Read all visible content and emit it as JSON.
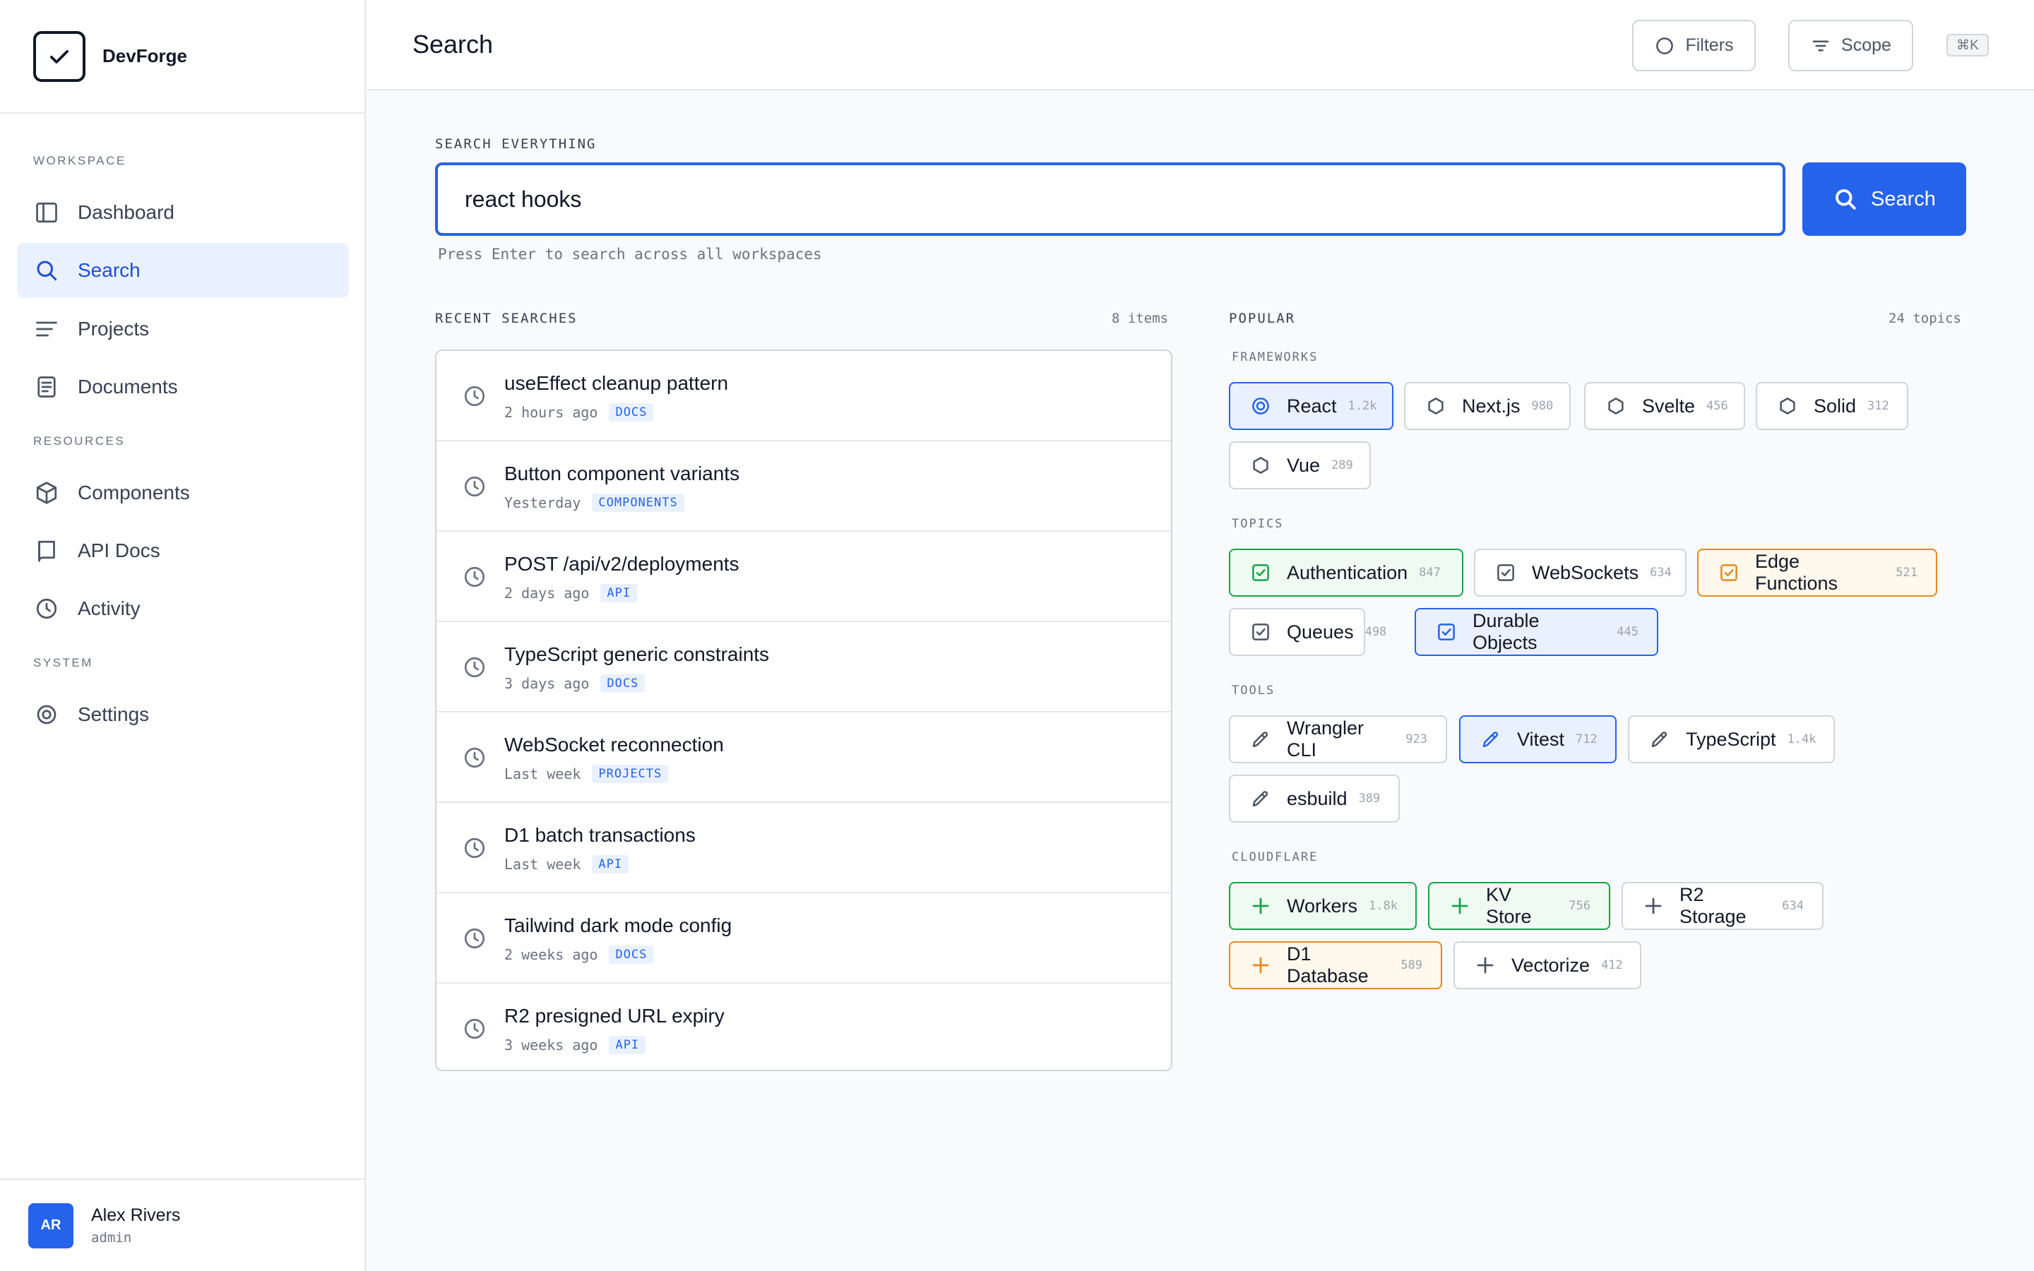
{
  "app": {
    "name": "DevForge",
    "page_title": "Search"
  },
  "sidebar": {
    "sections": [
      "WORKSPACE",
      "RESOURCES",
      "SYSTEM"
    ],
    "items": [
      {
        "label": "Dashboard",
        "icon": "layout-icon",
        "active": false
      },
      {
        "label": "Search",
        "icon": "search-icon",
        "active": true
      },
      {
        "label": "Projects",
        "icon": "lines-icon",
        "active": false
      },
      {
        "label": "Documents",
        "icon": "document-icon",
        "active": false
      },
      {
        "label": "Components",
        "icon": "box-icon",
        "active": false
      },
      {
        "label": "API Docs",
        "icon": "book-icon",
        "active": false
      },
      {
        "label": "Activity",
        "icon": "clock-icon",
        "active": false
      },
      {
        "label": "Settings",
        "icon": "gear-icon",
        "active": false
      }
    ],
    "user": {
      "initials": "AR",
      "name": "Alex Rivers",
      "role": "admin"
    }
  },
  "header": {
    "filters_label": "Filters",
    "scope_label": "Scope",
    "shortcut": "⌘K"
  },
  "search": {
    "label": "SEARCH EVERYTHING",
    "value": "react hooks",
    "button_label": "Search",
    "hint": "Press Enter to search across all workspaces"
  },
  "recent": {
    "title": "RECENT SEARCHES",
    "count": "8 items",
    "items": [
      {
        "title": "useEffect cleanup pattern",
        "time": "2 hours ago",
        "tag": "DOCS"
      },
      {
        "title": "Button component variants",
        "time": "Yesterday",
        "tag": "COMPONENTS"
      },
      {
        "title": "POST /api/v2/deployments",
        "time": "2 days ago",
        "tag": "API"
      },
      {
        "title": "TypeScript generic constraints",
        "time": "3 days ago",
        "tag": "DOCS"
      },
      {
        "title": "WebSocket reconnection",
        "time": "Last week",
        "tag": "PROJECTS"
      },
      {
        "title": "D1 batch transactions",
        "time": "Last week",
        "tag": "API"
      },
      {
        "title": "Tailwind dark mode config",
        "time": "2 weeks ago",
        "tag": "DOCS"
      },
      {
        "title": "R2 presigned URL expiry",
        "time": "3 weeks ago",
        "tag": "API"
      }
    ]
  },
  "popular": {
    "title": "POPULAR",
    "count": "24 topics",
    "groups": [
      {
        "title": "FRAMEWORKS",
        "chips": [
          {
            "label": "React",
            "count": "1.2k",
            "style": "blue",
            "icon": "target-icon"
          },
          {
            "label": "Next.js",
            "count": "980",
            "style": "plain",
            "icon": "hexagon-icon"
          },
          {
            "label": "Svelte",
            "count": "456",
            "style": "plain",
            "icon": "hexagon-icon"
          },
          {
            "label": "Solid",
            "count": "312",
            "style": "plain",
            "icon": "hexagon-icon"
          },
          {
            "label": "Vue",
            "count": "289",
            "style": "plain",
            "icon": "hexagon-icon"
          }
        ]
      },
      {
        "title": "TOPICS",
        "chips": [
          {
            "label": "Authentication",
            "count": "847",
            "style": "green",
            "icon": "checkbox-icon"
          },
          {
            "label": "WebSockets",
            "count": "634",
            "style": "plain",
            "icon": "checkbox-icon"
          },
          {
            "label": "Edge Functions",
            "count": "521",
            "style": "orange",
            "icon": "checkbox-icon"
          },
          {
            "label": "Queues",
            "count": "498",
            "style": "plain",
            "icon": "checkbox-icon"
          },
          {
            "label": "Durable Objects",
            "count": "445",
            "style": "blue",
            "icon": "checkbox-icon"
          }
        ]
      },
      {
        "title": "TOOLS",
        "chips": [
          {
            "label": "Wrangler CLI",
            "count": "923",
            "style": "plain",
            "icon": "pencil-icon"
          },
          {
            "label": "Vitest",
            "count": "712",
            "style": "blue",
            "icon": "pencil-icon"
          },
          {
            "label": "TypeScript",
            "count": "1.4k",
            "style": "plain",
            "icon": "pencil-icon"
          },
          {
            "label": "esbuild",
            "count": "389",
            "style": "plain",
            "icon": "pencil-icon"
          }
        ]
      },
      {
        "title": "CLOUDFLARE",
        "chips": [
          {
            "label": "Workers",
            "count": "1.8k",
            "style": "green",
            "icon": "plus-icon"
          },
          {
            "label": "KV Store",
            "count": "756",
            "style": "green",
            "icon": "plus-icon"
          },
          {
            "label": "R2 Storage",
            "count": "634",
            "style": "plain",
            "icon": "plus-icon"
          },
          {
            "label": "D1 Database",
            "count": "589",
            "style": "orange",
            "icon": "plus-icon"
          },
          {
            "label": "Vectorize",
            "count": "412",
            "style": "plain",
            "icon": "plus-icon"
          }
        ]
      }
    ]
  },
  "colors": {
    "accent": "#2563eb",
    "accent_soft": "#eaf1fe",
    "green": "#16a34a",
    "orange": "#e58a1f",
    "text": "#111827",
    "muted": "#6b7280"
  }
}
